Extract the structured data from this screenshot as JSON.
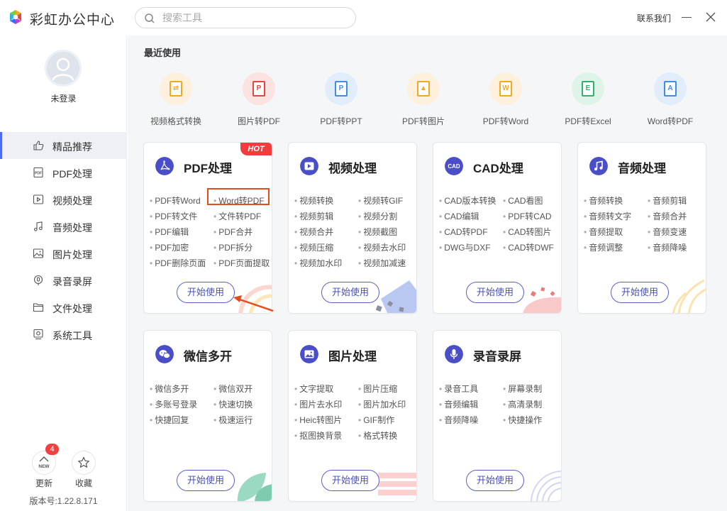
{
  "app": {
    "title": "彩虹办公中心"
  },
  "search": {
    "placeholder": "搜索工具"
  },
  "header": {
    "contact": "联系我们"
  },
  "user": {
    "status": "未登录"
  },
  "nav": [
    {
      "label": "精品推荐",
      "icon": "thumbs-up-icon"
    },
    {
      "label": "PDF处理",
      "icon": "pdf-file-icon"
    },
    {
      "label": "视频处理",
      "icon": "video-play-icon"
    },
    {
      "label": "音频处理",
      "icon": "music-note-icon"
    },
    {
      "label": "图片处理",
      "icon": "image-icon"
    },
    {
      "label": "录音录屏",
      "icon": "microphone-icon"
    },
    {
      "label": "文件处理",
      "icon": "folder-icon"
    },
    {
      "label": "系统工具",
      "icon": "system-tools-icon"
    }
  ],
  "bottom": {
    "update_label": "更新",
    "update_badge": "4",
    "update_icon_text": "NEW",
    "favorite_label": "收藏",
    "version": "版本号:1.22.8.171"
  },
  "recent": {
    "title": "最近使用",
    "items": [
      {
        "label": "视频格式转换",
        "color": "#f5a623",
        "glyph": "⇄"
      },
      {
        "label": "图片转PDF",
        "color": "#e8453c",
        "glyph": "P"
      },
      {
        "label": "PDF转PPT",
        "color": "#3d8ee8",
        "glyph": "P"
      },
      {
        "label": "PDF转图片",
        "color": "#f5a623",
        "glyph": "▲"
      },
      {
        "label": "PDF转Word",
        "color": "#f5a623",
        "glyph": "W"
      },
      {
        "label": "PDF转Excel",
        "color": "#2fb36a",
        "glyph": "E"
      },
      {
        "label": "Word转PDF",
        "color": "#3d8ee8",
        "glyph": "A"
      }
    ]
  },
  "cards": [
    {
      "title": "PDF处理",
      "hot": "HOT",
      "button": "开始使用",
      "features": [
        "PDF转Word",
        "Word转PDF",
        "PDF转文件",
        "文件转PDF",
        "PDF编辑",
        "PDF合并",
        "PDF加密",
        "PDF拆分",
        "PDF删除页面",
        "PDF页面提取"
      ]
    },
    {
      "title": "视频处理",
      "button": "开始使用",
      "features": [
        "视频转换",
        "视频转GIF",
        "视频剪辑",
        "视频分割",
        "视频合并",
        "视频截图",
        "视频压缩",
        "视频去水印",
        "视频加水印",
        "视频加减速"
      ]
    },
    {
      "title": "CAD处理",
      "icon_text": "CAD",
      "button": "开始使用",
      "features": [
        "CAD版本转换",
        "CAD看图",
        "CAD编辑",
        "PDF转CAD",
        "CAD转PDF",
        "CAD转图片",
        "DWG与DXF",
        "CAD转DWF"
      ]
    },
    {
      "title": "音频处理",
      "button": "开始使用",
      "features": [
        "音频转换",
        "音频剪辑",
        "音频转文字",
        "音频合并",
        "音频提取",
        "音频变速",
        "音频调整",
        "音频降噪"
      ]
    },
    {
      "title": "微信多开",
      "button": "开始使用",
      "features": [
        "微信多开",
        "微信双开",
        "多账号登录",
        "快速切换",
        "快捷回复",
        "极速运行"
      ]
    },
    {
      "title": "图片处理",
      "button": "开始使用",
      "features": [
        "文字提取",
        "图片压缩",
        "图片去水印",
        "图片加水印",
        "Heic转图片",
        "GIF制作",
        "抠图换背景",
        "格式转换"
      ]
    },
    {
      "title": "录音录屏",
      "button": "开始使用",
      "features": [
        "录音工具",
        "屏幕录制",
        "音频编辑",
        "高清录制",
        "音频降噪",
        "快捷操作"
      ]
    }
  ]
}
